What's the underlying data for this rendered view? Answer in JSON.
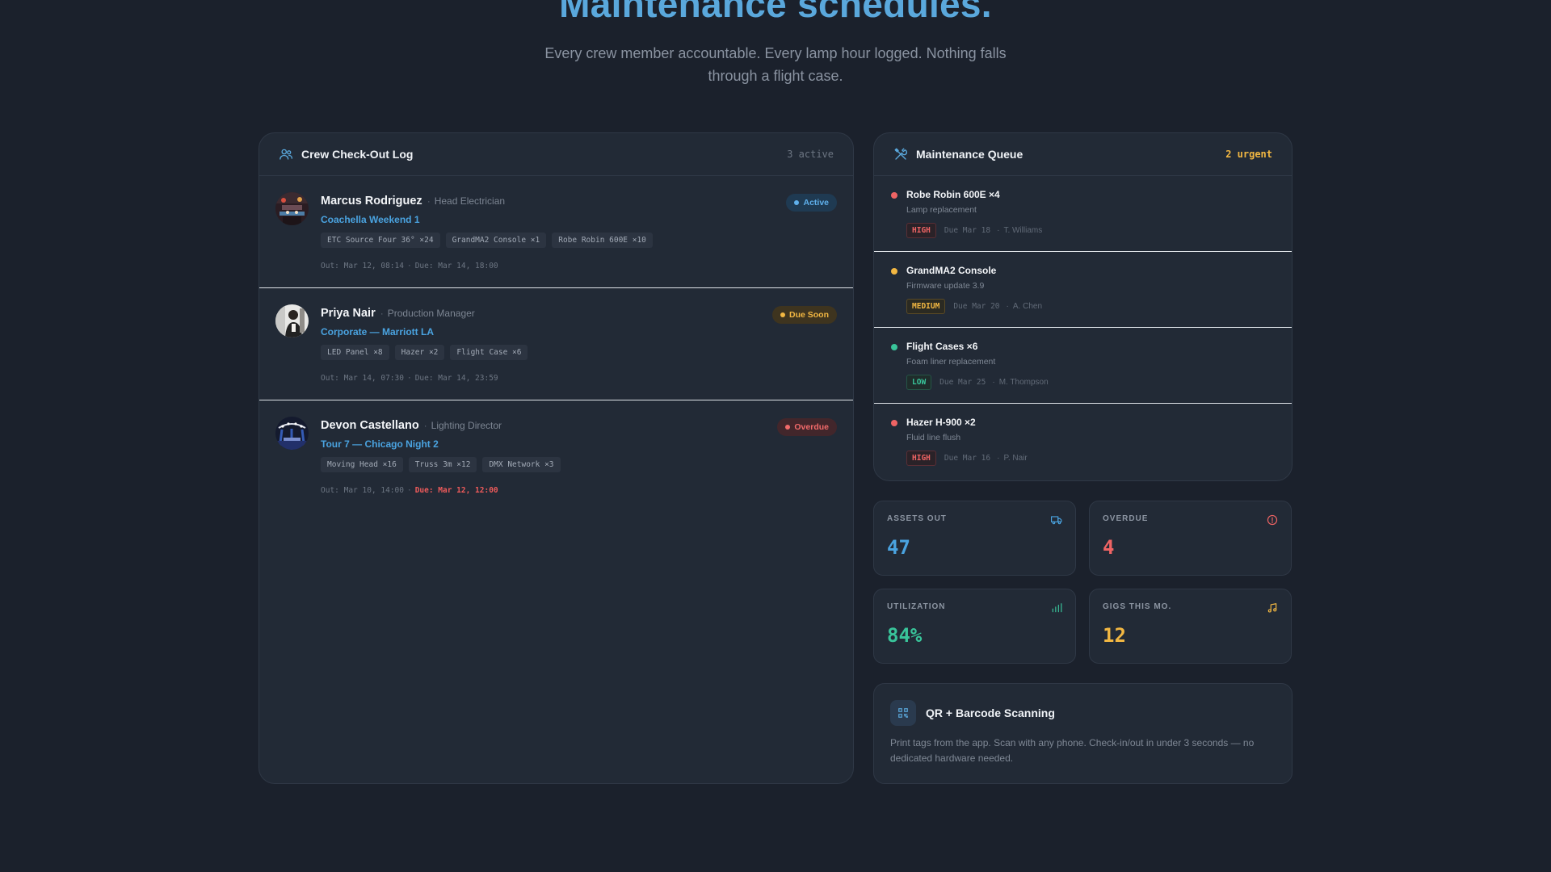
{
  "hero": {
    "title": "Maintenance schedules.",
    "subtitle": "Every crew member accountable. Every lamp hour logged. Nothing falls through a flight case."
  },
  "colors": {
    "background": "#1b212c",
    "panel": "#222a36",
    "accent_blue": "#5aa8dc",
    "red": "#ef6464",
    "amber": "#f2b742",
    "green": "#39c49a"
  },
  "crew_log": {
    "title": "Crew Check-Out Log",
    "count": "3 active",
    "icon": "users-icon",
    "entries": [
      {
        "name": "Marcus Rodriguez",
        "role": "Head Electrician",
        "event": "Coachella Weekend 1",
        "status": "Active",
        "items": [
          "ETC Source Four 36° ×24",
          "GrandMA2 Console ×1",
          "Robe Robin 600E ×10"
        ],
        "out": "Out: Mar 12, 08:14",
        "due": "Due: Mar 14, 18:00",
        "overdue": false
      },
      {
        "name": "Priya Nair",
        "role": "Production Manager",
        "event": "Corporate — Marriott LA",
        "status": "Due Soon",
        "items": [
          "LED Panel ×8",
          "Hazer ×2",
          "Flight Case ×6"
        ],
        "out": "Out: Mar 14, 07:30",
        "due": "Due: Mar 14, 23:59",
        "overdue": false
      },
      {
        "name": "Devon Castellano",
        "role": "Lighting Director",
        "event": "Tour 7 — Chicago Night 2",
        "status": "Overdue",
        "items": [
          "Moving Head ×16",
          "Truss 3m ×12",
          "DMX Network ×3"
        ],
        "out": "Out: Mar 10, 14:00",
        "due": "Due: Mar 12, 12:00",
        "overdue": true
      }
    ]
  },
  "maintenance_queue": {
    "title": "Maintenance Queue",
    "count": "2 urgent",
    "icon": "tools-icon",
    "items": [
      {
        "title": "Robe Robin 600E ×4",
        "desc": "Lamp replacement",
        "priority": "HIGH",
        "due": "Due Mar 18",
        "assignee": "T. Williams"
      },
      {
        "title": "GrandMA2 Console",
        "desc": "Firmware update 3.9",
        "priority": "MEDIUM",
        "due": "Due Mar 20",
        "assignee": "A. Chen"
      },
      {
        "title": "Flight Cases ×6",
        "desc": "Foam liner replacement",
        "priority": "LOW",
        "due": "Due Mar 25",
        "assignee": "M. Thompson"
      },
      {
        "title": "Hazer H-900 ×2",
        "desc": "Fluid line flush",
        "priority": "HIGH",
        "due": "Due Mar 16",
        "assignee": "P. Nair"
      }
    ]
  },
  "stats": {
    "assets_out": {
      "label": "ASSETS OUT",
      "value": "47",
      "icon": "truck-icon",
      "color": "#4aa3e0"
    },
    "overdue": {
      "label": "OVERDUE",
      "value": "4",
      "icon": "alert-circle-icon",
      "color": "#ef6464"
    },
    "utilization": {
      "label": "UTILIZATION",
      "value": "84%",
      "icon": "bar-chart-icon",
      "color": "#39c49a"
    },
    "gigs": {
      "label": "GIGS THIS MO.",
      "value": "12",
      "icon": "music-note-icon",
      "color": "#f2b742"
    }
  },
  "qr_card": {
    "title": "QR + Barcode Scanning",
    "text": "Print tags from the app. Scan with any phone. Check-in/out in under 3 seconds — no dedicated hardware needed.",
    "icon": "qr-code-icon"
  }
}
